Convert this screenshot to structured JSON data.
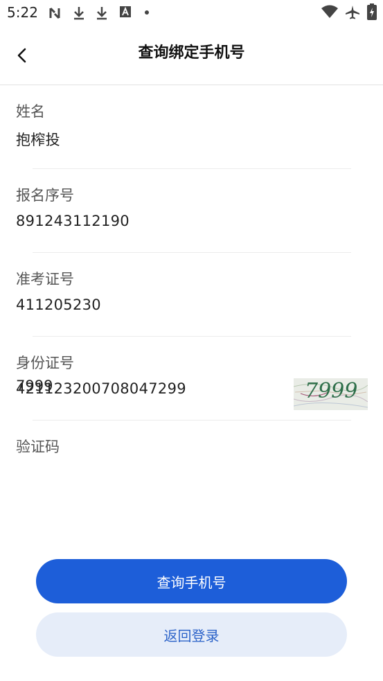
{
  "status_bar": {
    "time": "5:22",
    "left_icons": [
      "sync-icon",
      "download-icon",
      "download-icon",
      "text-a-icon",
      "dot-icon"
    ],
    "right_icons": [
      "wifi-icon",
      "airplane-icon",
      "battery-icon"
    ]
  },
  "header": {
    "title": "查询绑定手机号",
    "back_icon": "chevron-left-icon"
  },
  "form": {
    "name_label": "姓名",
    "name_value": "抱榨投",
    "reg_label": "报名序号",
    "reg_value": "891243112190",
    "exam_label": "准考证号",
    "exam_value": "411205230",
    "id_label": "身份证号",
    "id_value": "421123200708047299",
    "captcha_label": "验证码",
    "captcha_value": "7999",
    "captcha_image_text": "7999"
  },
  "buttons": {
    "query_label": "查询手机号",
    "back_login_label": "返回登录"
  },
  "colors": {
    "primary": "#1d5ed9",
    "secondary_bg": "#e6edf9",
    "secondary_text": "#2c63c9"
  }
}
